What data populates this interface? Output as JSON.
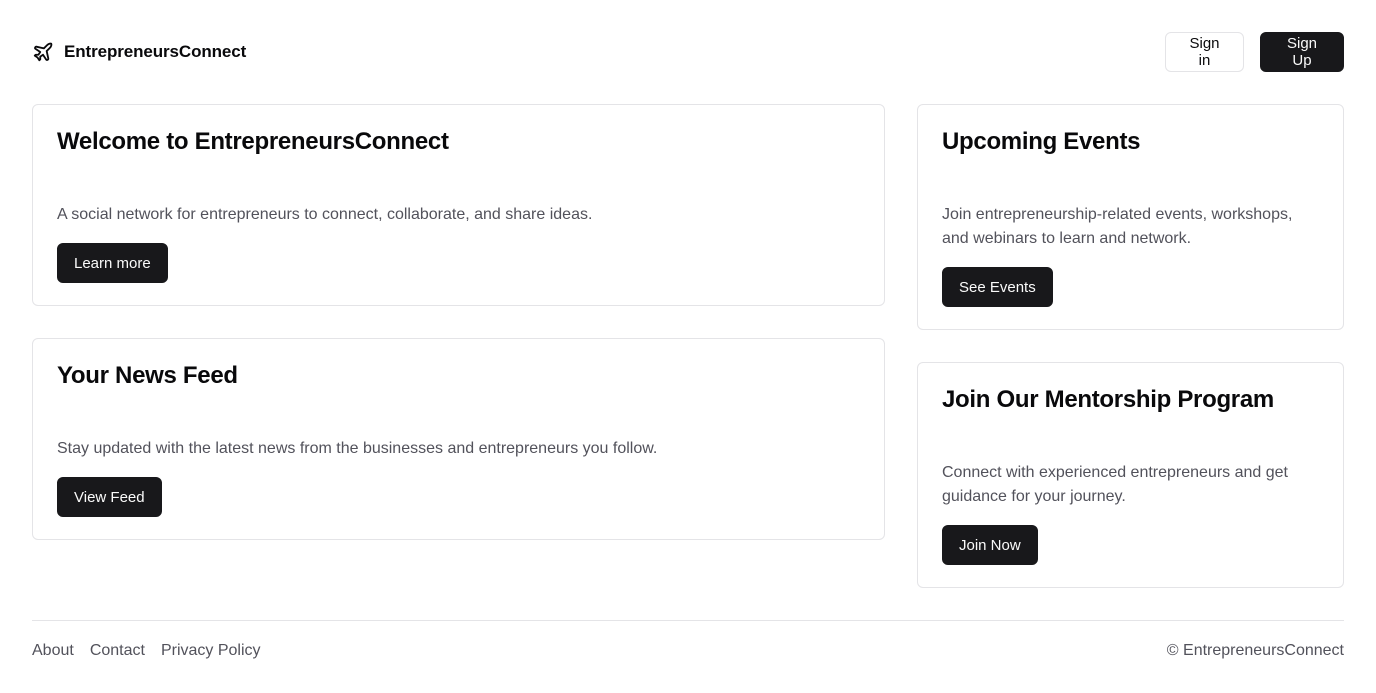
{
  "header": {
    "brand": "EntrepreneursConnect",
    "brand_icon": "plane-icon",
    "sign_in": "Sign in",
    "sign_up": "Sign Up"
  },
  "cards": {
    "welcome": {
      "title": "Welcome to EntrepreneursConnect",
      "description": "A social network for entrepreneurs to connect, collaborate, and share ideas.",
      "button": "Learn more"
    },
    "feed": {
      "title": "Your News Feed",
      "description": "Stay updated with the latest news from the businesses and entrepreneurs you follow.",
      "button": "View Feed"
    },
    "events": {
      "title": "Upcoming Events",
      "description": "Join entrepreneurship-related events, workshops, and webinars to learn and network.",
      "button": "See Events"
    },
    "mentor": {
      "title": "Join Our Mentorship Program",
      "description": "Connect with experienced entrepreneurs and get guidance for your journey.",
      "button": "Join Now"
    }
  },
  "footer": {
    "links": [
      "About",
      "Contact",
      "Privacy Policy"
    ],
    "copyright": "© EntrepreneursConnect"
  },
  "colors": {
    "primary": "#18181b",
    "border": "#e4e4e7",
    "muted_text": "#52525b"
  }
}
